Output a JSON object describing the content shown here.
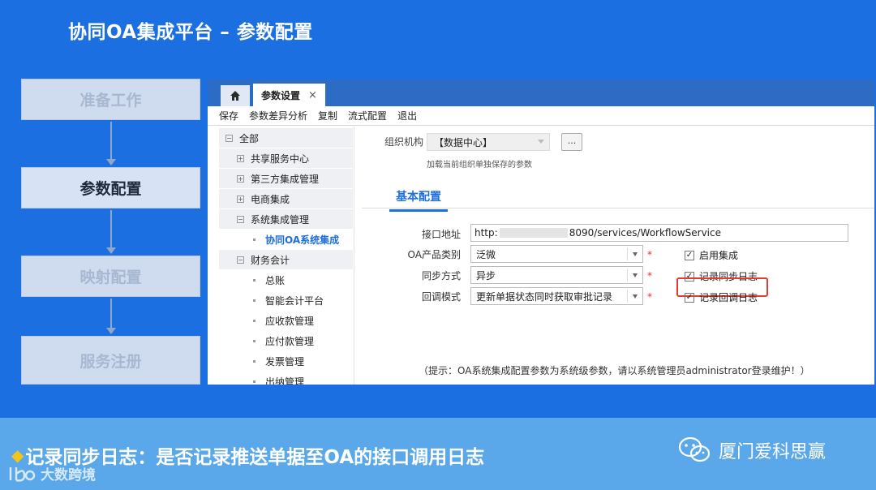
{
  "title": "协同OA集成平台 – 参数配置",
  "steps": [
    {
      "label": "准备工作"
    },
    {
      "label": "参数配置"
    },
    {
      "label": "映射配置"
    },
    {
      "label": "服务注册"
    }
  ],
  "window": {
    "tab_active": "参数设置",
    "tab_close": "×",
    "toolbar": [
      "保存",
      "参数差异分析",
      "复制",
      "流式配置",
      "退出"
    ],
    "tree": [
      {
        "label": "全部",
        "toggle": "⊟",
        "type": "group"
      },
      {
        "label": "共享服务中心",
        "toggle": "+",
        "type": "group"
      },
      {
        "label": "第三方集成管理",
        "toggle": "+",
        "type": "group"
      },
      {
        "label": "电商集成",
        "toggle": "+",
        "type": "group"
      },
      {
        "label": "系统集成管理",
        "toggle": "−",
        "type": "group"
      },
      {
        "label": "协同OA系统集成",
        "type": "leaf",
        "selected": true
      },
      {
        "label": "财务会计",
        "toggle": "−",
        "type": "group"
      },
      {
        "label": "总账",
        "type": "leaf"
      },
      {
        "label": "智能会计平台",
        "type": "leaf"
      },
      {
        "label": "应收款管理",
        "type": "leaf"
      },
      {
        "label": "应付款管理",
        "type": "leaf"
      },
      {
        "label": "发票管理",
        "type": "leaf"
      },
      {
        "label": "出纳管理",
        "type": "leaf"
      }
    ],
    "form": {
      "org_label": "组织机构",
      "org_value": "【数据中心】",
      "ellipsis": "...",
      "org_hint": "加载当前组织单独保存的参数",
      "subtab": "基本配置",
      "url_label": "接口地址",
      "url_prefix": "http:",
      "url_suffix": "8090/services/WorkflowService",
      "oa_type_label": "OA产品类别",
      "oa_type_value": "泛微",
      "sync_label": "同步方式",
      "sync_value": "异步",
      "callback_label": "回调模式",
      "callback_value": "更新单据状态同时获取审批记录",
      "required_mark": "*",
      "chk_enable": "启用集成",
      "chk_sync_log": "记录同步日志",
      "chk_callback_log": "记录回调日志",
      "check_glyph": "✓",
      "tip": "（提示：OA系统集成配置参数为系统级参数，请以系统管理员administrator登录维护！）"
    }
  },
  "bottom": {
    "bullet": "◆",
    "caption": "记录同步日志：是否记录推送单据至OA的接口调用日志",
    "brand": "厦门爱科思赢",
    "watermark": "大数跨境"
  },
  "colors": {
    "background": "#1c6fe0",
    "bottom_bar": "#5aa8ea",
    "accent_blue": "#1f6fd8",
    "highlight_red": "#e53a2f",
    "bullet_yellow": "#f4c518"
  }
}
